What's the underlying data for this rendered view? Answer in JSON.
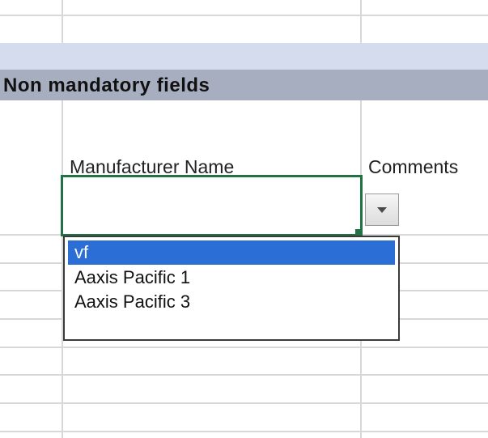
{
  "section": {
    "title": "Non mandatory fields"
  },
  "columns": {
    "manufacturer_name": "Manufacturer Name",
    "comments": "Comments"
  },
  "active_cell": {
    "value": ""
  },
  "dropdown": {
    "icon": "chevron-down-icon",
    "items": [
      {
        "label": "vf",
        "selected": true
      },
      {
        "label": "Aaxis Pacific 1",
        "selected": false
      },
      {
        "label": "Aaxis Pacific 3",
        "selected": false
      }
    ]
  },
  "colors": {
    "active_border": "#217346",
    "selection": "#2b6fd6",
    "band_light": "#d4dcee",
    "band_dark": "#a6aebf"
  }
}
